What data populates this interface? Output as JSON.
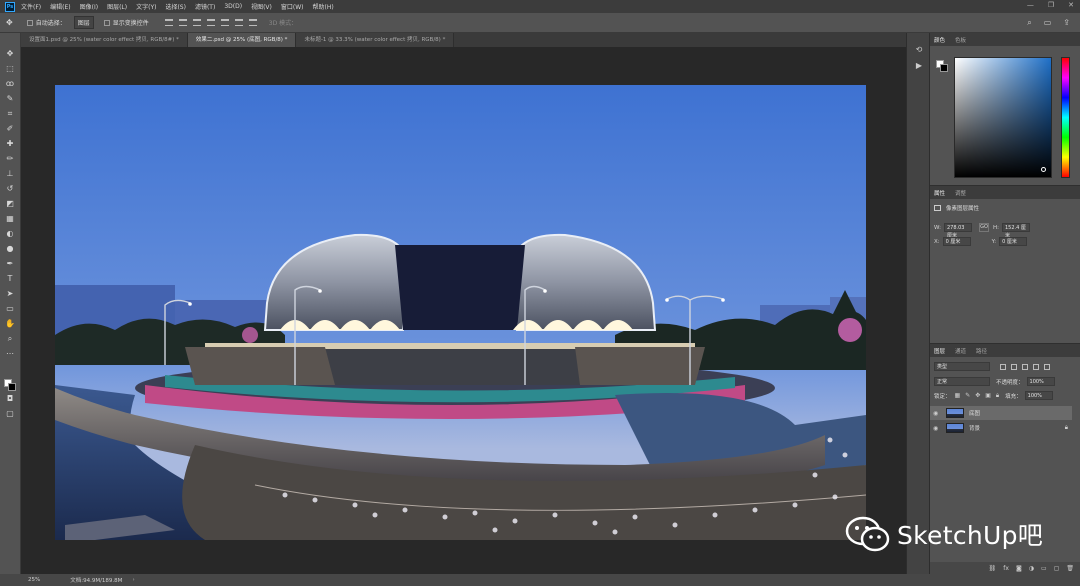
{
  "menu": {
    "items": [
      "文件(F)",
      "编辑(E)",
      "图像(I)",
      "图层(L)",
      "文字(Y)",
      "选择(S)",
      "滤镜(T)",
      "3D(D)",
      "视图(V)",
      "窗口(W)",
      "帮助(H)"
    ],
    "app_logo": "Ps"
  },
  "options": {
    "auto_select_label": "自动选择：",
    "auto_select_target": "图层",
    "show_transform_label": "显示变换控件",
    "mode_3d_label": "3D 模式："
  },
  "tabs": [
    {
      "label": "设置面1.psd @ 25% (water color effect 拷贝, RGB/8#) *",
      "active": false
    },
    {
      "label": "效果二.psd @ 25% (底图, RGB/8) *",
      "active": true
    },
    {
      "label": "未标题-1 @ 33.3% (water color effect 拷贝, RGB/8) *",
      "active": false
    }
  ],
  "status": {
    "zoom": "25%",
    "doc_size": "文档:94.9M/189.8M"
  },
  "color_panel": {
    "tabs": [
      "颜色",
      "色板"
    ],
    "hue_color": "#1e6fc7"
  },
  "properties_panel": {
    "tabs": [
      "属性",
      "调整"
    ],
    "heading": "像素图层属性",
    "w_label": "W:",
    "w_value": "278.03 厘米",
    "h_label": "H:",
    "h_value": "152.4 厘米",
    "link_icon": "GO",
    "x_label": "X:",
    "x_value": "0 厘米",
    "y_label": "Y:",
    "y_value": "0 厘米"
  },
  "layers_panel": {
    "tabs": [
      "图层",
      "通道",
      "路径"
    ],
    "filter_kind": "类型",
    "blend_mode": "正常",
    "opacity_label": "不透明度：",
    "opacity_value": "100%",
    "lock_label": "锁定：",
    "fill_label": "填充：",
    "fill_value": "100%",
    "layers": [
      {
        "name": "底图",
        "selected": true,
        "locked": false
      },
      {
        "name": "背景",
        "selected": false,
        "locked": true
      }
    ]
  },
  "watermark": {
    "text": "SketchUp吧"
  }
}
